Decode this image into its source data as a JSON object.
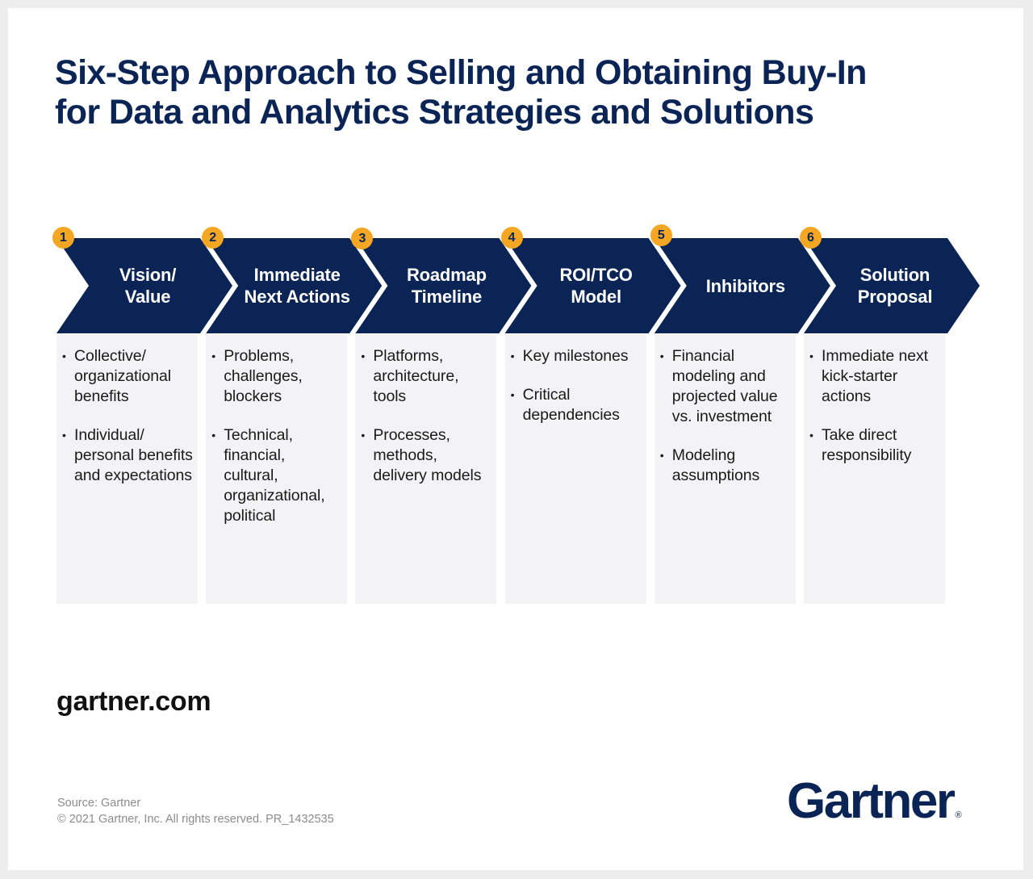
{
  "title": {
    "line1": "Six-Step Approach to Selling and Obtaining Buy-In",
    "line2": "for Data and Analytics Strategies and Solutions"
  },
  "colors": {
    "navy": "#0b2456",
    "badge": "#f5a623",
    "panel": "#f3f3f6",
    "background": "#ededed"
  },
  "steps": [
    {
      "number": "1",
      "label_lines": [
        "Vision/",
        "Value"
      ],
      "bullets": [
        "Collective/ organizational benefits",
        "Individual/ personal benefits and expectations"
      ]
    },
    {
      "number": "2",
      "label_lines": [
        "Immediate",
        "Next Actions"
      ],
      "bullets": [
        "Problems, challenges, blockers",
        "Technical, financial, cultural, organizational, political"
      ]
    },
    {
      "number": "3",
      "label_lines": [
        "Roadmap",
        "Timeline"
      ],
      "bullets": [
        "Platforms, architecture, tools",
        "Processes, methods, delivery models"
      ]
    },
    {
      "number": "4",
      "label_lines": [
        "ROI/TCO",
        "Model"
      ],
      "bullets": [
        "Key milestones",
        "Critical dependencies"
      ]
    },
    {
      "number": "5",
      "label_lines": [
        "Inhibitors"
      ],
      "bullets": [
        "Financial modeling and projected value vs. investment",
        "Modeling assumptions"
      ]
    },
    {
      "number": "6",
      "label_lines": [
        "Solution",
        "Proposal"
      ],
      "bullets": [
        "Immediate next kick-starter actions",
        "Take direct responsibility"
      ]
    }
  ],
  "footer": {
    "site": "gartner.com",
    "source": "Source: Gartner",
    "copyright": "© 2021 Gartner, Inc. All rights reserved. PR_1432535",
    "logo": "Gartner",
    "logo_mark": "®"
  }
}
